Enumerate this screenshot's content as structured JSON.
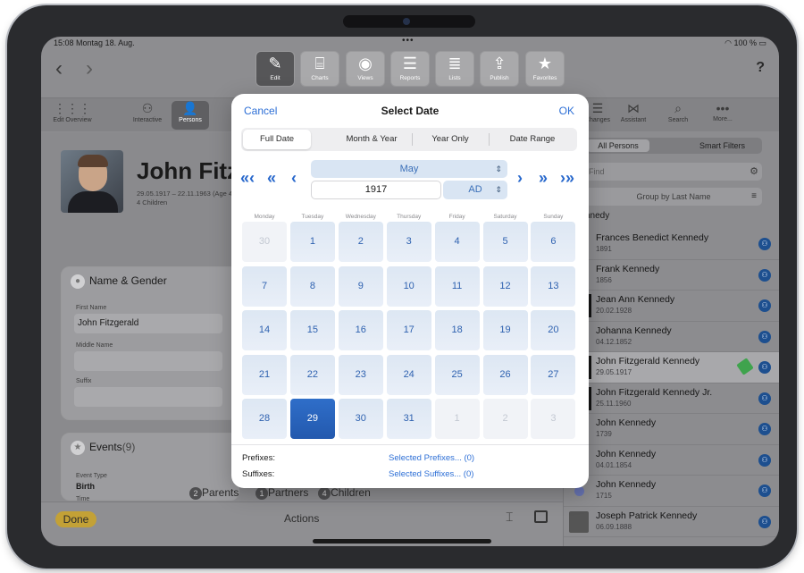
{
  "status": {
    "time": "15:08",
    "date": "Montag 18. Aug.",
    "battery": "100 %"
  },
  "toolbar": {
    "buttons": [
      {
        "label": "Edit",
        "icon": "pencil-icon",
        "glyph": "✎"
      },
      {
        "label": "Charts",
        "icon": "chart-icon",
        "glyph": "⌸"
      },
      {
        "label": "Views",
        "icon": "eye-icon",
        "glyph": "◉"
      },
      {
        "label": "Reports",
        "icon": "report-icon",
        "glyph": "☰"
      },
      {
        "label": "Lists",
        "icon": "list-icon",
        "glyph": "≣"
      },
      {
        "label": "Publish",
        "icon": "upload-icon",
        "glyph": "⇪"
      },
      {
        "label": "Favorites",
        "icon": "star-icon",
        "glyph": "★"
      }
    ],
    "help": "?"
  },
  "toolbar2": {
    "left": [
      {
        "label": "Edit Overview",
        "glyph": "⋮⋮⋮"
      },
      {
        "label": "Interactive",
        "glyph": "⚇"
      },
      {
        "label": "Persons",
        "glyph": "👤"
      }
    ],
    "right": [
      {
        "label": "Changes",
        "glyph": "☰"
      },
      {
        "label": "Assistant",
        "glyph": "⋈"
      },
      {
        "label": "Search",
        "glyph": "⌕"
      },
      {
        "label": "More...",
        "glyph": "•••"
      }
    ]
  },
  "person": {
    "name": "John Fitz",
    "dates": "29.05.1917 – 22.11.1963 (Age 46)",
    "children": "4 Children"
  },
  "name_card": {
    "title": "Name & Gender",
    "first_label": "First Name",
    "first_value": "John Fitzgerald",
    "middle_label": "Middle Name",
    "suffix_label": "Suffix"
  },
  "events_card": {
    "title": "Events",
    "count": "(9)",
    "type_label": "Event Type",
    "type_value": "Birth",
    "time_label": "Time"
  },
  "tabs": {
    "parents_num": "2",
    "parents": "Parents",
    "partners_num": "1",
    "partners": "Partners",
    "children_num": "4",
    "children": "Children"
  },
  "bottom": {
    "done": "Done",
    "actions": "Actions"
  },
  "sidebar": {
    "seg_all": "All Persons",
    "seg_smart": "Smart Filters",
    "find_placeholder": "Find",
    "group": "Group by Last Name",
    "section": "nnedy",
    "persons": [
      {
        "name": "Frances Benedict Kennedy",
        "date": "1891"
      },
      {
        "name": "Frank Kennedy",
        "date": "1856"
      },
      {
        "name": "Jean Ann Kennedy",
        "date": "20.02.1928"
      },
      {
        "name": "Johanna Kennedy",
        "date": "04.12.1852"
      },
      {
        "name": "John Fitzgerald Kennedy",
        "date": "29.05.1917"
      },
      {
        "name": "John Fitzgerald Kennedy Jr.",
        "date": "25.11.1960"
      },
      {
        "name": "John Kennedy",
        "date": "1739"
      },
      {
        "name": "John Kennedy",
        "date": "04.01.1854"
      },
      {
        "name": "John Kennedy",
        "date": "1715"
      },
      {
        "name": "Joseph Patrick Kennedy",
        "date": "06.09.1888"
      }
    ]
  },
  "modal": {
    "cancel": "Cancel",
    "title": "Select Date",
    "ok": "OK",
    "modes": [
      "Full Date",
      "Month & Year",
      "Year Only",
      "Date Range"
    ],
    "month": "May",
    "year": "1917",
    "era": "AD",
    "weekdays": [
      "Monday",
      "Tuesday",
      "Wednesday",
      "Thursday",
      "Friday",
      "Saturday",
      "Sunday"
    ],
    "days": [
      "30",
      "1",
      "2",
      "3",
      "4",
      "5",
      "6",
      "7",
      "8",
      "9",
      "10",
      "11",
      "12",
      "13",
      "14",
      "15",
      "16",
      "17",
      "18",
      "19",
      "20",
      "21",
      "22",
      "23",
      "24",
      "25",
      "26",
      "27",
      "28",
      "29",
      "30",
      "31",
      "1",
      "2",
      "3"
    ],
    "selected_day": "29",
    "prefixes_label": "Prefixes:",
    "prefixes_value": "Selected Prefixes... (0)",
    "suffixes_label": "Suffixes:",
    "suffixes_value": "Selected Suffixes... (0)"
  }
}
